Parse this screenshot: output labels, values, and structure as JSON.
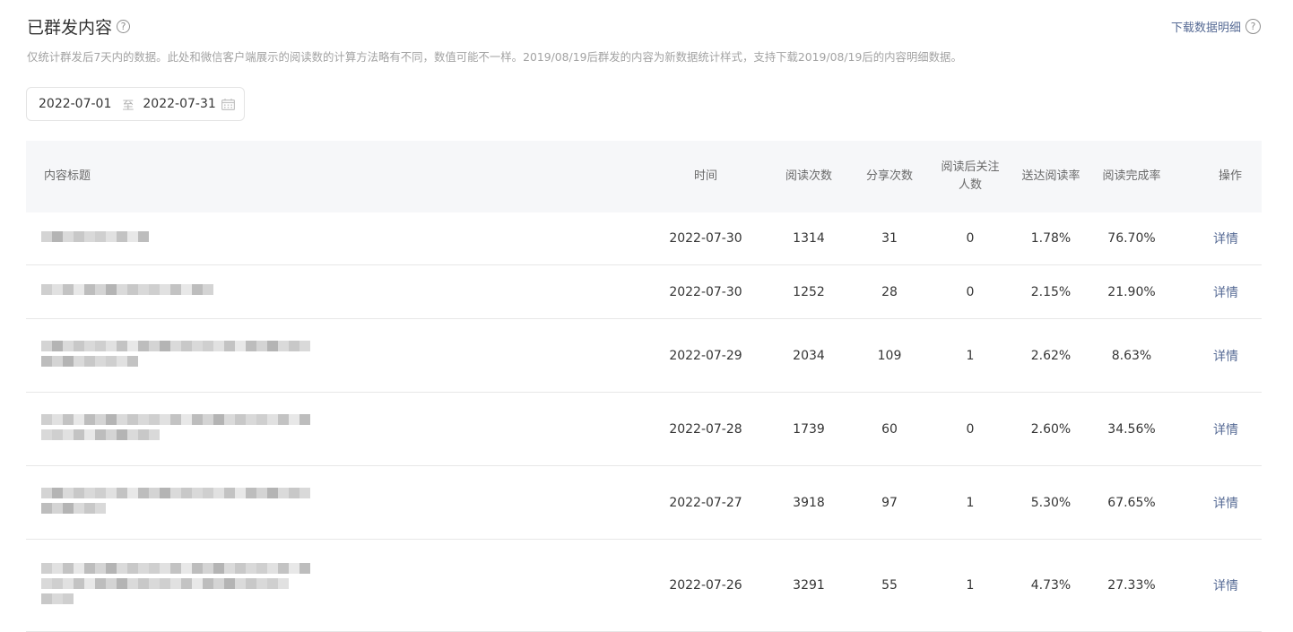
{
  "header": {
    "title": "已群发内容",
    "help_glyph": "?",
    "download_label": "下载数据明细",
    "subtitle": "仅统计群发后7天内的数据。此处和微信客户端展示的阅读数的计算方法略有不同，数值可能不一样。2019/08/19后群发的内容为新数据统计样式，支持下载2019/08/19后的内容明细数据。"
  },
  "date_range": {
    "start": "2022-07-01",
    "separator": "至",
    "end": "2022-07-31"
  },
  "table": {
    "columns": {
      "title": "内容标题",
      "time": "时间",
      "reads": "阅读次数",
      "shares": "分享次数",
      "follow_line1": "阅读后关注",
      "follow_line2": "人数",
      "delivery_rate": "送达阅读率",
      "completion_rate": "阅读完成率",
      "action": "操作"
    },
    "rows": [
      {
        "time": "2022-07-30",
        "reads": "1314",
        "shares": "31",
        "follow": "0",
        "delivery_rate": "1.78%",
        "completion_rate": "76.70%",
        "action": "详情"
      },
      {
        "time": "2022-07-30",
        "reads": "1252",
        "shares": "28",
        "follow": "0",
        "delivery_rate": "2.15%",
        "completion_rate": "21.90%",
        "action": "详情"
      },
      {
        "time": "2022-07-29",
        "reads": "2034",
        "shares": "109",
        "follow": "1",
        "delivery_rate": "2.62%",
        "completion_rate": "8.63%",
        "action": "详情"
      },
      {
        "time": "2022-07-28",
        "reads": "1739",
        "shares": "60",
        "follow": "0",
        "delivery_rate": "2.60%",
        "completion_rate": "34.56%",
        "action": "详情"
      },
      {
        "time": "2022-07-27",
        "reads": "3918",
        "shares": "97",
        "follow": "1",
        "delivery_rate": "5.30%",
        "completion_rate": "67.65%",
        "action": "详情"
      },
      {
        "time": "2022-07-26",
        "reads": "3291",
        "shares": "55",
        "follow": "1",
        "delivery_rate": "4.73%",
        "completion_rate": "27.33%",
        "action": "详情"
      }
    ]
  },
  "colors": {
    "link": "#576b95",
    "header_bg": "#f6f7f9",
    "border": "#e7e7e7"
  },
  "icons": {
    "help": "question-circle-icon",
    "calendar": "calendar-icon"
  }
}
